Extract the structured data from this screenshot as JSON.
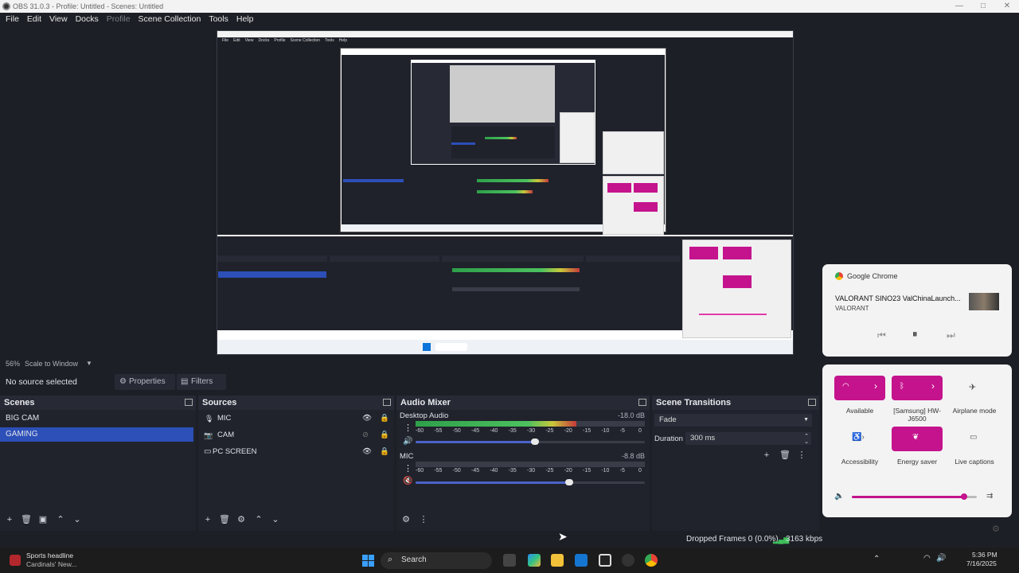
{
  "window": {
    "title": "OBS 31.0.3 - Profile: Untitled - Scenes: Untitled",
    "minimize": "—",
    "maximize": "□",
    "close": "✕"
  },
  "menu": [
    {
      "label": "File"
    },
    {
      "label": "Edit"
    },
    {
      "label": "View"
    },
    {
      "label": "Docks"
    },
    {
      "label": "Profile"
    },
    {
      "label": "Scene Collection"
    },
    {
      "label": "Tools"
    },
    {
      "label": "Help"
    }
  ],
  "preview": {
    "zoom": "56%",
    "scale_mode": "Scale to Window"
  },
  "source_toolbar": {
    "no_source": "No source selected",
    "properties": "Properties",
    "filters": "Filters"
  },
  "scenes": {
    "title": "Scenes",
    "items": [
      {
        "label": "BIG CAM"
      },
      {
        "label": "GAMING"
      }
    ],
    "selected_index": 1
  },
  "sources": {
    "title": "Sources",
    "items": [
      {
        "label": "MIC",
        "icon": "microphone-icon",
        "visible": true,
        "locked": true
      },
      {
        "label": "CAM",
        "icon": "camera-icon",
        "visible": false,
        "locked": true
      },
      {
        "label": "PC SCREEN",
        "icon": "monitor-icon",
        "visible": true,
        "locked": true
      }
    ]
  },
  "audio_mixer": {
    "title": "Audio Mixer",
    "channels": [
      {
        "name": "Desktop Audio",
        "db": "-18.0 dB",
        "level": 0.7,
        "volume": 0.52,
        "muted": false
      },
      {
        "name": "MIC",
        "db": "-8.8 dB",
        "level": 0.0,
        "volume": 0.67,
        "muted": true
      }
    ],
    "ticks": [
      "-60",
      "-55",
      "-50",
      "-45",
      "-40",
      "-35",
      "-30",
      "-25",
      "-20",
      "-15",
      "-10",
      "-5",
      "0"
    ]
  },
  "scene_transitions": {
    "title": "Scene Transitions",
    "transition": "Fade",
    "duration_label": "Duration",
    "duration": "300 ms"
  },
  "status": {
    "dropped_frames": "Dropped Frames 0 (0.0%)",
    "bitrate": "3163 kbps"
  },
  "media_popup": {
    "app": "Google Chrome",
    "title": "VALORANT SINO23 ValChinaLaunch...",
    "subtitle": "VALORANT"
  },
  "quick_settings": {
    "tiles": [
      {
        "label": "Available",
        "icon": "wifi-icon",
        "active": true
      },
      {
        "label": "[Samsung] HW-J6500",
        "icon": "bluetooth-icon",
        "active": true
      },
      {
        "label": "Airplane mode",
        "icon": "airplane-icon",
        "active": false
      },
      {
        "label": "Accessibility",
        "icon": "accessibility-icon",
        "active": false
      },
      {
        "label": "Energy saver",
        "icon": "leaf-icon",
        "active": true
      },
      {
        "label": "Live captions",
        "icon": "captions-icon",
        "active": false
      }
    ],
    "volume": 0.9
  },
  "taskbar": {
    "news_title": "Sports headline",
    "news_sub": "Cardinals' New...",
    "search": "Search",
    "time": "5:36 PM",
    "date": "7/16/2025"
  },
  "colors": {
    "accent": "#2c4fb8",
    "pink": "#c4138d",
    "bg": "#1d1f26"
  }
}
